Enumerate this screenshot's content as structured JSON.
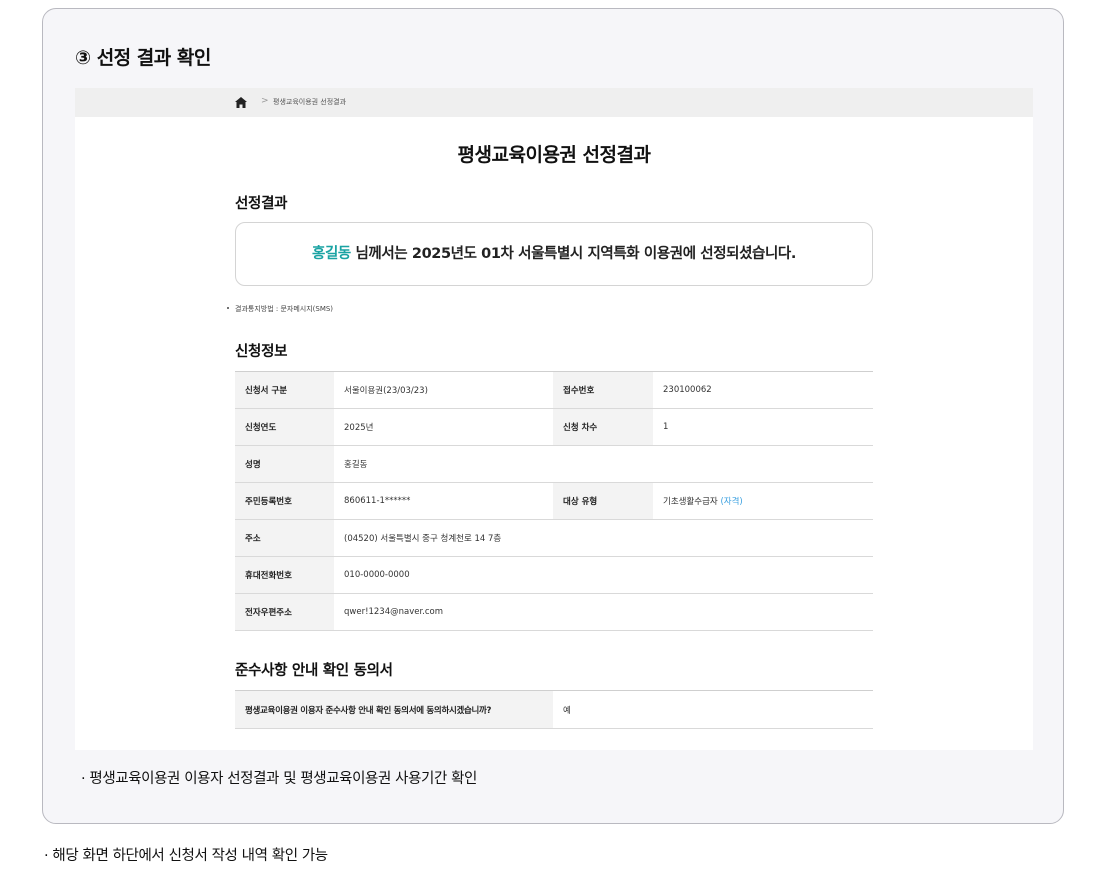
{
  "step_title": "③ 선정 결과 확인",
  "breadcrumb": {
    "home_icon": "home-icon",
    "separator": ">",
    "current": "평생교육이용권 선정결과"
  },
  "page_title": "평생교육이용권 선정결과",
  "result": {
    "section_title": "선정결과",
    "name": "홍길동",
    "message": " 님께서는 2025년도 01차 서울특별시 지역특화 이용권에 선정되셨습니다.",
    "notice": "결과통지방법 : 문자메시지(SMS)",
    "name_color": "#1aa3a3"
  },
  "application": {
    "section_title": "신청정보",
    "rows": [
      {
        "l1": "신청서 구분",
        "v1": "서울이용권(23/03/23)",
        "l2": "접수번호",
        "v2": "230100062"
      },
      {
        "l1": "신청연도",
        "v1": "2025년",
        "l2": "신청 차수",
        "v2": "1"
      },
      {
        "l1": "성명",
        "v1": "홍길동"
      },
      {
        "l1": "주민등록번호",
        "v1": "860611-1******",
        "l2": "대상 유형",
        "v2": "기초생활수급자",
        "v2_link": "(자격)"
      },
      {
        "l1": "주소",
        "v1": "(04520) 서울특별시 중구 청계천로 14 7층"
      },
      {
        "l1": "휴대전화번호",
        "v1": "010-0000-0000"
      },
      {
        "l1": "전자우편주소",
        "v1": "qwer!1234@naver.com"
      }
    ]
  },
  "consent": {
    "section_title": "준수사항 안내 확인 동의서",
    "question": "평생교육이용권 이용자 준수사항 안내 확인 동의서에 동의하시겠습니까?",
    "answer": "예"
  },
  "bullets": {
    "first": "· 평생교육이용권 이용자 선정결과 및 평생교육이용권 사용기간 확인",
    "second": "· 해당 화면 하단에서 신청서 작성 내역 확인 가능"
  }
}
